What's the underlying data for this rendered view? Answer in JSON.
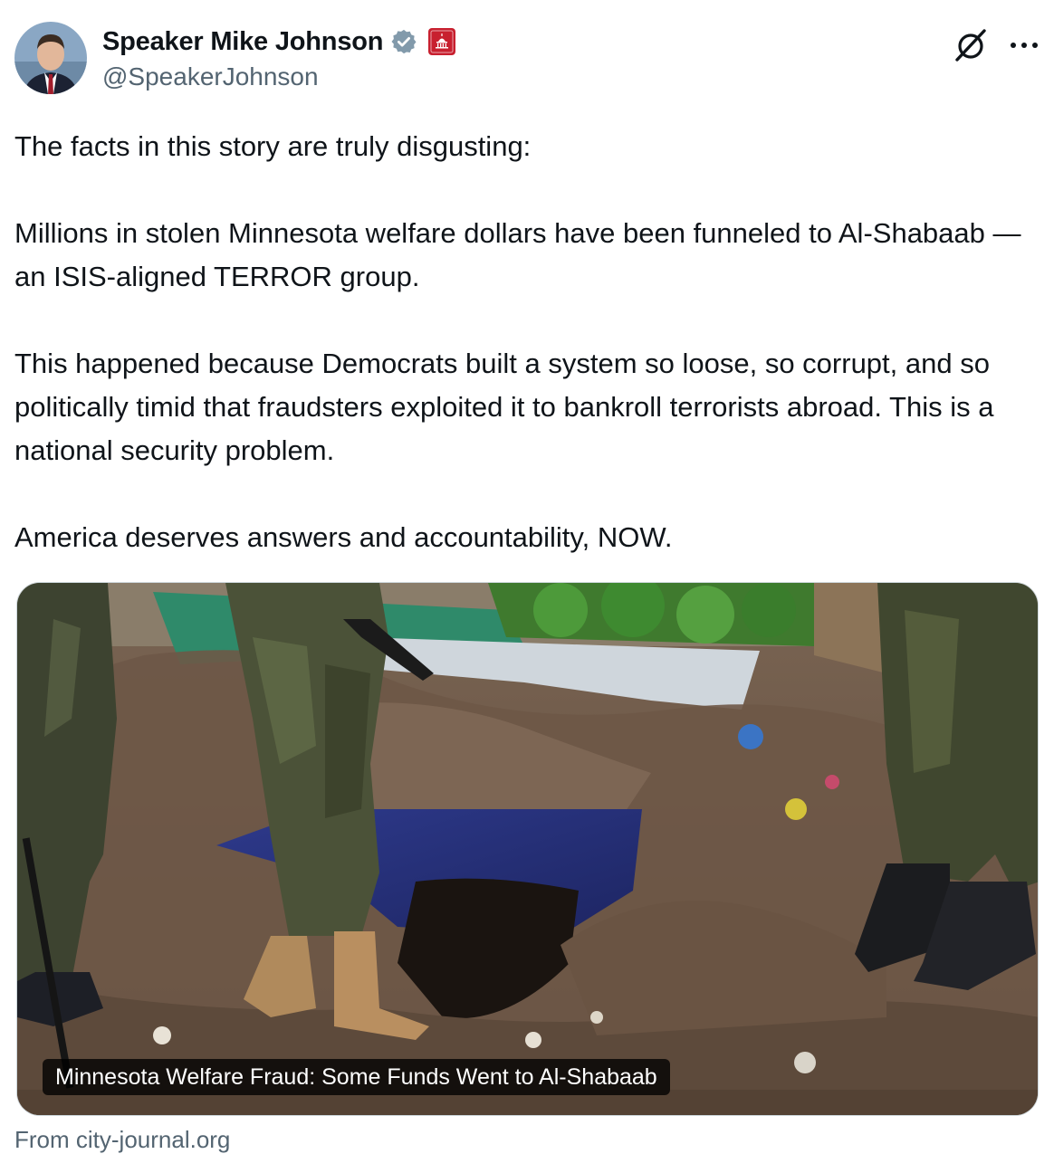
{
  "author": {
    "display_name": "Speaker Mike Johnson",
    "handle": "@SpeakerJohnson",
    "verified_badge_color": "#829aab",
    "affiliation_badge_color": "#c8202f"
  },
  "icons": {
    "verified": "verified-badge-icon",
    "affiliation": "capitol-badge-icon",
    "grok": "grok-icon",
    "more": "more-options-icon"
  },
  "tweet": {
    "paragraphs": [
      "The facts in this story are truly disgusting:",
      "Millions in stolen Minnesota welfare dollars have been funneled to Al-Shabaab — an ISIS-aligned TERROR group.",
      "This happened because Democrats built a system so loose, so corrupt, and so politically timid that fraudsters exploited it to bankroll terrorists abroad. This is a national security problem.",
      "America deserves answers and accountability, NOW."
    ]
  },
  "card": {
    "caption": "Minnesota Welfare Fraud: Some Funds Went to Al-Shabaab",
    "source": "From city-journal.org"
  },
  "colors": {
    "text_primary": "#0f1419",
    "text_secondary": "#536471",
    "border": "#cfd9de"
  }
}
